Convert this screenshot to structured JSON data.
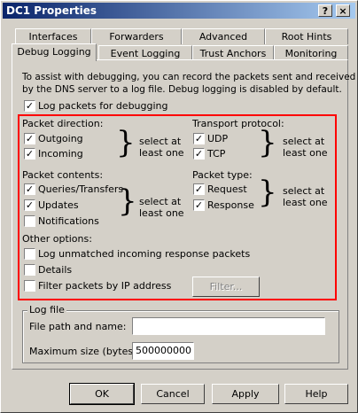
{
  "window": {
    "title": "DC1 Properties",
    "help_button": "?",
    "close_button": "×"
  },
  "tabs_row1": [
    "Interfaces",
    "Forwarders",
    "Advanced",
    "Root Hints"
  ],
  "tabs_row2": [
    "Debug Logging",
    "Event Logging",
    "Trust Anchors",
    "Monitoring"
  ],
  "intro": {
    "line1": "To assist with debugging, you can record the packets sent and received",
    "line2": "by the DNS server to a log file. Debug logging is disabled by default."
  },
  "log_packets": {
    "label": "Log packets for debugging",
    "checked": true
  },
  "packet_direction": {
    "heading": "Packet direction:",
    "outgoing": {
      "label": "Outgoing",
      "checked": true
    },
    "incoming": {
      "label": "Incoming",
      "checked": true
    },
    "hint_line1": "select at",
    "hint_line2": "least one"
  },
  "transport_protocol": {
    "heading": "Transport protocol:",
    "udp": {
      "label": "UDP",
      "checked": true
    },
    "tcp": {
      "label": "TCP",
      "checked": true
    },
    "hint_line1": "select at",
    "hint_line2": "least one"
  },
  "packet_contents": {
    "heading": "Packet contents:",
    "queries": {
      "label": "Queries/Transfers",
      "checked": true
    },
    "updates": {
      "label": "Updates",
      "checked": true
    },
    "notifications": {
      "label": "Notifications",
      "checked": false
    },
    "hint_line1": "select at",
    "hint_line2": "least one"
  },
  "packet_type": {
    "heading": "Packet type:",
    "request": {
      "label": "Request",
      "checked": true
    },
    "response": {
      "label": "Response",
      "checked": true
    },
    "hint_line1": "select at",
    "hint_line2": "least one"
  },
  "other_options": {
    "heading": "Other options:",
    "log_unmatched": {
      "label": "Log unmatched incoming response packets",
      "checked": false
    },
    "details": {
      "label": "Details",
      "checked": false
    },
    "filter_ip": {
      "label": "Filter packets by IP address",
      "checked": false
    },
    "filter_button": "Filter..."
  },
  "log_file": {
    "group_label": "Log file",
    "path_label": "File path and name:",
    "path_value": "",
    "max_size_label": "Maximum size (bytes):",
    "max_size_value": "500000000"
  },
  "buttons": {
    "ok": "OK",
    "cancel": "Cancel",
    "apply": "Apply",
    "help": "Help"
  },
  "check_mark": "✓"
}
